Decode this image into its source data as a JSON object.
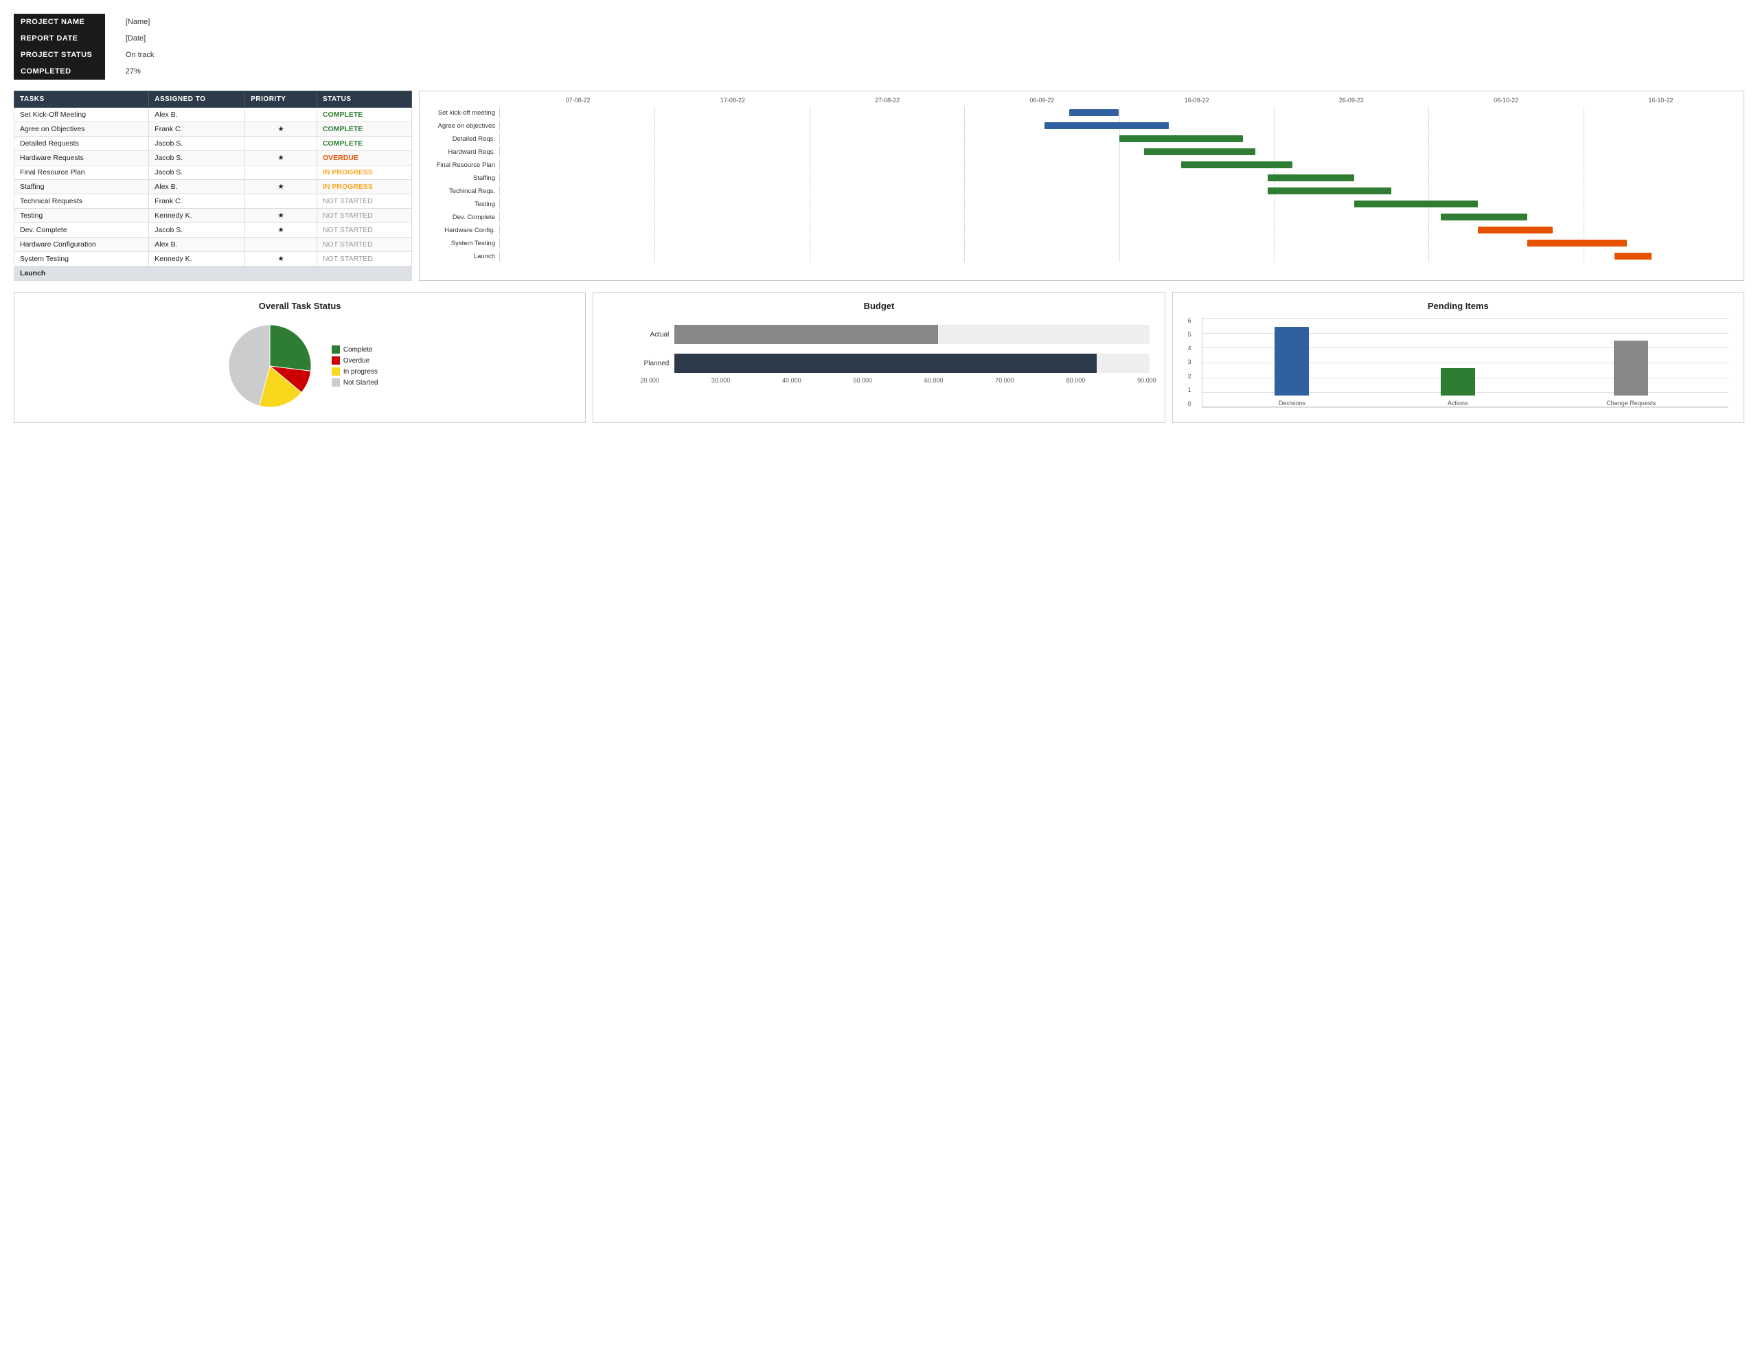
{
  "header": {
    "project_name_label": "PROJECT NAME",
    "project_name_value": "[Name]",
    "report_date_label": "REPORT DATE",
    "report_date_value": "[Date]",
    "project_status_label": "PROJECT STATUS",
    "project_status_value": "On track",
    "completed_label": "COMPLETED",
    "completed_value": "27%"
  },
  "task_table": {
    "headers": [
      "TASKS",
      "ASSIGNED TO",
      "PRIORITY",
      "STATUS"
    ],
    "rows": [
      {
        "task": "Set Kick-Off Meeting",
        "assigned": "Alex B.",
        "priority": "",
        "status": "COMPLETE",
        "status_class": "complete"
      },
      {
        "task": "Agree on Objectives",
        "assigned": "Frank C.",
        "priority": "★",
        "status": "COMPLETE",
        "status_class": "complete"
      },
      {
        "task": "Detailed Requests",
        "assigned": "Jacob S.",
        "priority": "",
        "status": "COMPLETE",
        "status_class": "complete"
      },
      {
        "task": "Hardware Requests",
        "assigned": "Jacob S.",
        "priority": "★",
        "status": "OVERDUE",
        "status_class": "overdue"
      },
      {
        "task": "Final Resource Plan",
        "assigned": "Jacob S.",
        "priority": "",
        "status": "IN PROGRESS",
        "status_class": "inprogress"
      },
      {
        "task": "Staffing",
        "assigned": "Alex B.",
        "priority": "★",
        "status": "IN PROGRESS",
        "status_class": "inprogress"
      },
      {
        "task": "Technical Requests",
        "assigned": "Frank C.",
        "priority": "",
        "status": "NOT STARTED",
        "status_class": "notstarted"
      },
      {
        "task": "Testing",
        "assigned": "Kennedy K.",
        "priority": "★",
        "status": "NOT STARTED",
        "status_class": "notstarted"
      },
      {
        "task": "Dev. Complete",
        "assigned": "Jacob S.",
        "priority": "★",
        "status": "NOT STARTED",
        "status_class": "notstarted"
      },
      {
        "task": "Hardware Configuration",
        "assigned": "Alex B.",
        "priority": "",
        "status": "NOT STARTED",
        "status_class": "notstarted"
      },
      {
        "task": "System Testing",
        "assigned": "Kennedy K.",
        "priority": "★",
        "status": "NOT STARTED",
        "status_class": "notstarted"
      }
    ],
    "launch_label": "Launch"
  },
  "gantt": {
    "dates": [
      "07-08-22",
      "17-08-22",
      "27-08-22",
      "06-09-22",
      "16-09-22",
      "26-09-22",
      "06-10-22",
      "16-10-22"
    ],
    "rows": [
      {
        "label": "Set kick-off meeting",
        "bars": [
          {
            "start": 46,
            "width": 4,
            "color": "blue"
          }
        ]
      },
      {
        "label": "Agree on objectives",
        "bars": [
          {
            "start": 44,
            "width": 10,
            "color": "blue"
          }
        ]
      },
      {
        "label": "Detailed Reqs.",
        "bars": [
          {
            "start": 50,
            "width": 10,
            "color": "green"
          }
        ]
      },
      {
        "label": "Hardward Reqs.",
        "bars": [
          {
            "start": 52,
            "width": 9,
            "color": "green"
          }
        ]
      },
      {
        "label": "Final Resource Plan",
        "bars": [
          {
            "start": 55,
            "width": 9,
            "color": "green"
          }
        ]
      },
      {
        "label": "Staffing",
        "bars": [
          {
            "start": 62,
            "width": 7,
            "color": "green"
          }
        ]
      },
      {
        "label": "Techincal Reqs.",
        "bars": [
          {
            "start": 62,
            "width": 10,
            "color": "green"
          }
        ]
      },
      {
        "label": "Testing",
        "bars": [
          {
            "start": 69,
            "width": 10,
            "color": "green"
          }
        ]
      },
      {
        "label": "Dev. Complete",
        "bars": [
          {
            "start": 76,
            "width": 7,
            "color": "green"
          }
        ]
      },
      {
        "label": "Hardware Config.",
        "bars": [
          {
            "start": 79,
            "width": 6,
            "color": "orange"
          }
        ]
      },
      {
        "label": "System Testing",
        "bars": [
          {
            "start": 83,
            "width": 8,
            "color": "orange"
          }
        ]
      },
      {
        "label": "Launch",
        "bars": [
          {
            "start": 90,
            "width": 3,
            "color": "orange"
          }
        ]
      }
    ]
  },
  "pie_chart": {
    "title": "Overall Task Status",
    "segments": [
      {
        "label": "Complete",
        "color": "#2e7d32",
        "value": 27,
        "angle_start": 0,
        "angle_end": 97
      },
      {
        "label": "Overdue",
        "color": "#cc0000",
        "value": 9,
        "angle_start": 97,
        "angle_end": 130
      },
      {
        "label": "In progress",
        "color": "#f9d71c",
        "value": 18,
        "angle_start": 130,
        "angle_end": 195
      },
      {
        "label": "Not Started",
        "color": "#cccccc",
        "value": 46,
        "angle_start": 195,
        "angle_end": 360
      }
    ]
  },
  "budget_chart": {
    "title": "Budget",
    "rows": [
      {
        "label": "Actual",
        "value": 50000,
        "max": 90000,
        "color": "#888888"
      },
      {
        "label": "Planned",
        "value": 80000,
        "max": 90000,
        "color": "#2d3a4a"
      }
    ],
    "x_labels": [
      "20.000",
      "30.000",
      "40.000",
      "50.000",
      "60.000",
      "70.000",
      "80.000",
      "90.000"
    ]
  },
  "pending_chart": {
    "title": "Pending Items",
    "y_labels": [
      "0",
      "1",
      "2",
      "3",
      "4",
      "5",
      "6"
    ],
    "bars": [
      {
        "label": "Decisions",
        "value": 5,
        "color": "#3060a0"
      },
      {
        "label": "Actions",
        "value": 2,
        "color": "#2e7d32"
      },
      {
        "label": "Change Requests",
        "value": 4,
        "color": "#888888"
      }
    ],
    "max_value": 6
  }
}
